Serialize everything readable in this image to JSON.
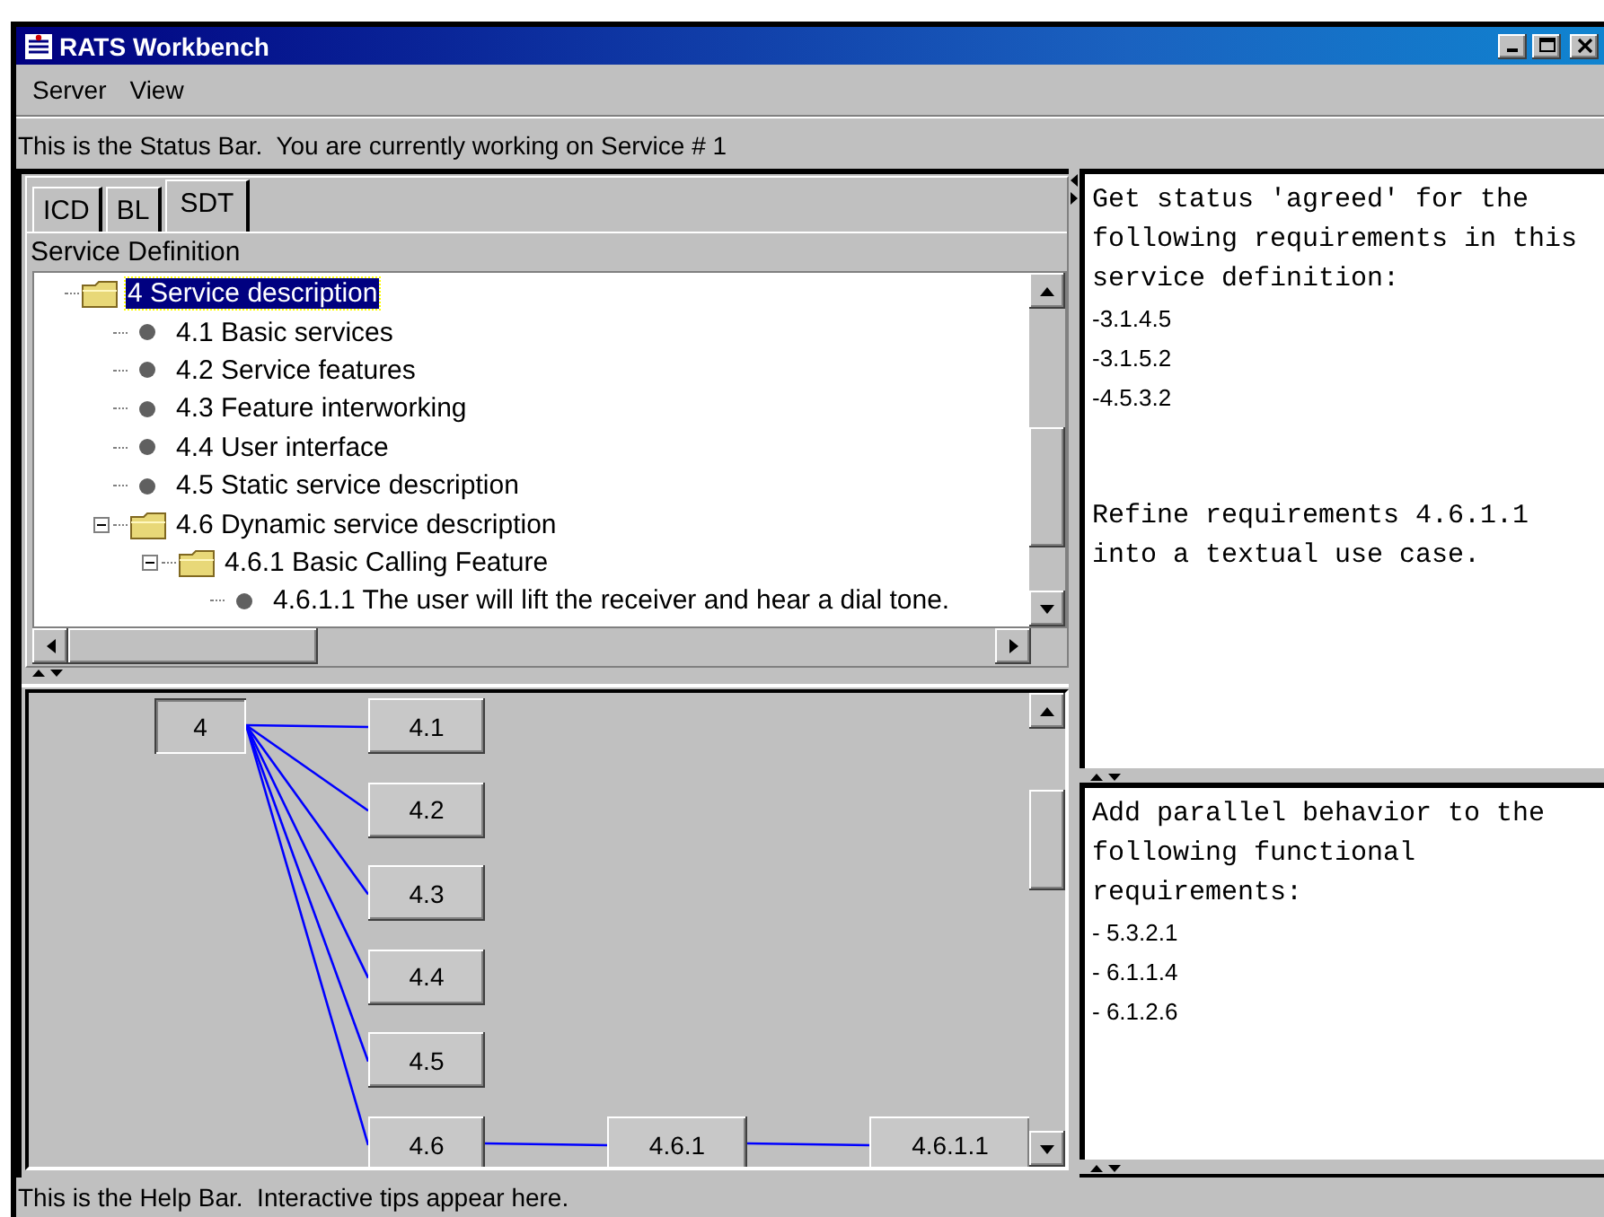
{
  "window": {
    "title": "RATS Workbench"
  },
  "menu": [
    "Server",
    "View"
  ],
  "status_bar": "This is the Status Bar.  You are currently working on Service # 1",
  "tabs": [
    {
      "label": "ICD",
      "selected": false
    },
    {
      "label": "BL",
      "selected": false
    },
    {
      "label": "SDT",
      "selected": true
    }
  ],
  "tree": {
    "header": "Service Definition",
    "items": [
      {
        "label": "4 Service description",
        "kind": "folder",
        "selected": true,
        "children": [
          {
            "label": "4.1 Basic services",
            "kind": "leaf",
            "selected": false
          },
          {
            "label": "4.2 Service features",
            "kind": "leaf",
            "selected": false
          },
          {
            "label": "4.3 Feature interworking",
            "kind": "leaf",
            "selected": false
          },
          {
            "label": "4.4 User interface",
            "kind": "leaf",
            "selected": false
          },
          {
            "label": "4.5 Static service description",
            "kind": "leaf",
            "selected": false
          },
          {
            "label": "4.6 Dynamic service description",
            "kind": "folder",
            "selected": false,
            "expanded": true,
            "children": [
              {
                "label": "4.6.1 Basic Calling Feature",
                "kind": "folder",
                "selected": false,
                "expanded": true,
                "children": [
                  {
                    "label": "4.6.1.1 The user will lift the receiver and hear a dial tone.",
                    "kind": "leaf",
                    "selected": false
                  }
                ]
              }
            ]
          }
        ]
      }
    ]
  },
  "graph": {
    "root": {
      "label": "4",
      "selected": true,
      "children": [
        {
          "label": "4.1",
          "selected": false
        },
        {
          "label": "4.2",
          "selected": false
        },
        {
          "label": "4.3",
          "selected": false
        },
        {
          "label": "4.4",
          "selected": false
        },
        {
          "label": "4.5",
          "selected": false
        },
        {
          "label": "4.6",
          "selected": false,
          "children": [
            {
              "label": "4.6.1",
              "selected": false,
              "children": [
                {
                  "label": "4.6.1.1",
                  "selected": false
                }
              ]
            }
          ]
        }
      ]
    }
  },
  "task_panels": [
    {
      "blocks": [
        {
          "kind": "paragraph",
          "text": "Get status 'agreed' for the following requirements in this service definition:"
        },
        {
          "kind": "requirement",
          "text": "-3.1.4.5"
        },
        {
          "kind": "requirement",
          "text": "-3.1.5.2"
        },
        {
          "kind": "requirement",
          "text": "-4.5.3.2"
        },
        {
          "kind": "paragraph",
          "text": "Refine requirements 4.6.1.1 into a textual use case."
        }
      ]
    },
    {
      "blocks": [
        {
          "kind": "paragraph",
          "text": "Add parallel behavior to the following functional requirements:"
        },
        {
          "kind": "requirement",
          "text": "- 5.3.2.1"
        },
        {
          "kind": "requirement",
          "text": "- 6.1.1.4"
        },
        {
          "kind": "requirement",
          "text": "- 6.1.2.6"
        }
      ]
    }
  ],
  "help_bar": "This is the Help Bar.  Interactive tips appear here."
}
